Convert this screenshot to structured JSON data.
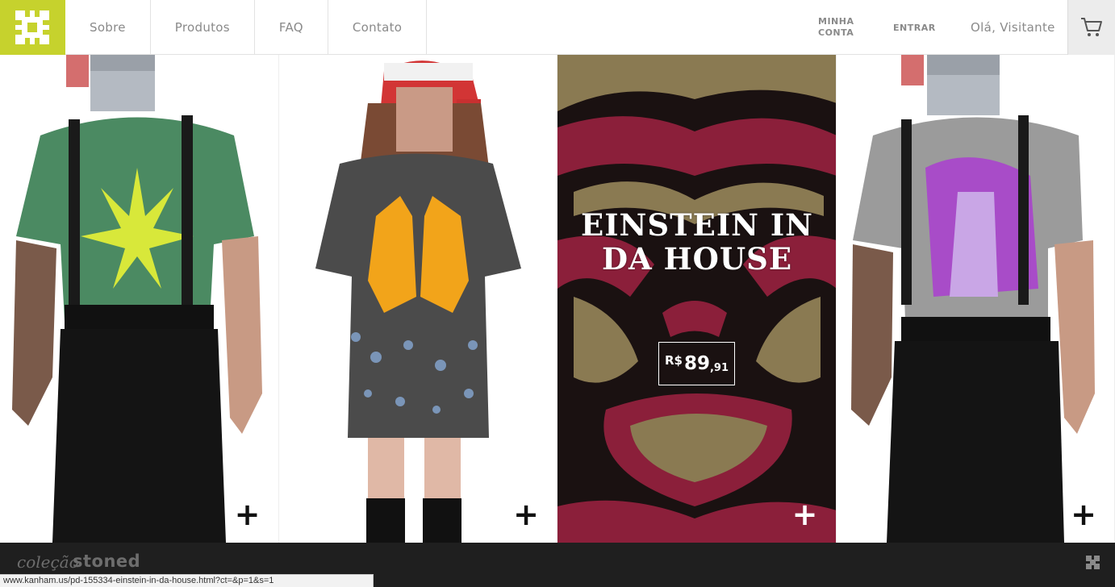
{
  "nav": {
    "items": [
      {
        "label": "Sobre"
      },
      {
        "label": "Produtos"
      },
      {
        "label": "FAQ"
      },
      {
        "label": "Contato"
      }
    ]
  },
  "account": {
    "minha": "MINHA",
    "conta": "CONTA",
    "entrar": "ENTRAR",
    "greeting": "Olá, Visitante"
  },
  "colors": {
    "brand_lime": "#c6d22d",
    "footer_bg": "#1f1f1f",
    "featured_red": "#8b1f3a",
    "featured_olive": "#8a7a52"
  },
  "icons": {
    "logo": "kanham-logo-icon",
    "cart": "cart-icon",
    "expand": "plus-icon",
    "footer": "kanham-mark-icon"
  },
  "products": [
    {
      "expand_label": "+"
    },
    {
      "expand_label": "+"
    },
    {
      "title": "EINSTEIN IN DA HOUSE",
      "price_currency": "R$",
      "price_int": "89",
      "price_dec": ",91",
      "expand_label": "+"
    },
    {
      "expand_label": "+"
    }
  ],
  "footer": {
    "collection_label": "coleção",
    "collection_name": "stoned"
  },
  "status_bar": {
    "url": "www.kanham.us/pd-155334-einstein-in-da-house.html?ct=&p=1&s=1"
  }
}
